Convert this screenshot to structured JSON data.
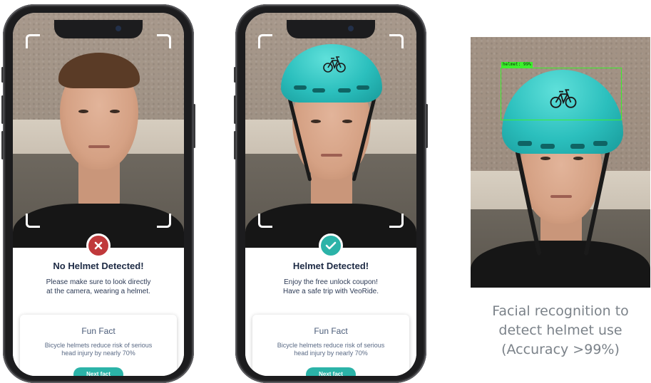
{
  "colors": {
    "fail_accent": "#c0393b",
    "success_accent": "#2bb3a8",
    "detection_box": "#3cf02c",
    "title_text": "#1d2a44"
  },
  "phones": [
    {
      "status": "fail",
      "status_icon": "close-icon",
      "title": "No Helmet Detected!",
      "message_line1": "Please make sure to look directly",
      "message_line2": "at the camera, wearing a helmet.",
      "fun_fact_title": "Fun Fact",
      "fun_fact_line1": "Bicycle helmets reduce risk of serious",
      "fun_fact_line2": "head injury by nearly 70%",
      "next_button_label": "Next fact"
    },
    {
      "status": "success",
      "status_icon": "check-icon",
      "title": "Helmet Detected!",
      "message_line1": "Enjoy the free unlock coupon!",
      "message_line2": "Have a safe trip with VeoRide.",
      "fun_fact_title": "Fun Fact",
      "fun_fact_line1": "Bicycle helmets reduce risk of serious",
      "fun_fact_line2": "head injury by nearly 70%",
      "next_button_label": "Next fact"
    }
  ],
  "detection": {
    "label": "helmet: 99%"
  },
  "caption": {
    "line1": "Facial recognition to",
    "line2": "detect helmet use",
    "line3": "(Accuracy >99%)"
  }
}
